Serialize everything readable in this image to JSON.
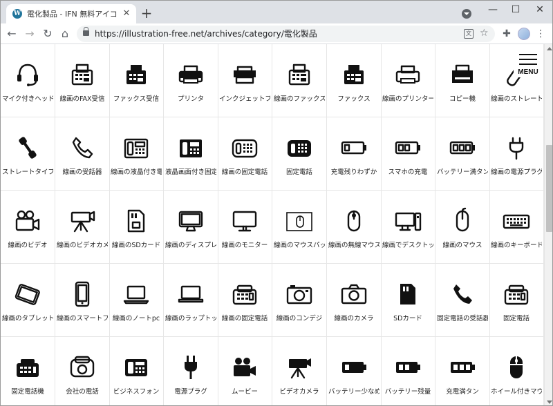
{
  "tab": {
    "title": "電化製品 - IFN 無料アイコン・S",
    "favicon": "wordpress-icon"
  },
  "toolbar": {
    "url": "https://illustration-free.net/archives/category/電化製品"
  },
  "page_menu": {
    "label": "MENU"
  },
  "icons": [
    {
      "label": "マイク付きヘッドセット",
      "icon": "headset-icon"
    },
    {
      "label": "線画のFAX受信",
      "icon": "fax-outline-icon"
    },
    {
      "label": "ファックス受信",
      "icon": "fax-filled-icon"
    },
    {
      "label": "プリンタ",
      "icon": "printer-icon"
    },
    {
      "label": "インクジェットプリンタ",
      "icon": "inkjet-printer-icon"
    },
    {
      "label": "線画のファックス",
      "icon": "fax-line-icon"
    },
    {
      "label": "ファックス",
      "icon": "fax-icon"
    },
    {
      "label": "線画のプリンター",
      "icon": "printer-outline-icon"
    },
    {
      "label": "コピー機",
      "icon": "copier-icon"
    },
    {
      "label": "線画のストレート",
      "icon": "receiver-outline-icon"
    },
    {
      "label": "ストレートタイプ",
      "icon": "receiver-filled-icon"
    },
    {
      "label": "線画の受話器",
      "icon": "handset-outline-icon"
    },
    {
      "label": "線画の液晶付き電話",
      "icon": "lcd-phone-outline-icon"
    },
    {
      "label": "液晶画面付き固定電話",
      "icon": "lcd-phone-filled-icon"
    },
    {
      "label": "線画の固定電話",
      "icon": "desk-phone-outline-icon"
    },
    {
      "label": "固定電話",
      "icon": "desk-phone-filled-icon"
    },
    {
      "label": "充電残りわずか",
      "icon": "battery-low-icon"
    },
    {
      "label": "スマホの充電",
      "icon": "battery-half-icon"
    },
    {
      "label": "バッテリー満タン",
      "icon": "battery-full-icon"
    },
    {
      "label": "線画の電源プラグ",
      "icon": "plug-outline-icon"
    },
    {
      "label": "線画のビデオ",
      "icon": "video-camera-outline-icon"
    },
    {
      "label": "線画のビデオカメラ",
      "icon": "tripod-camera-outline-icon"
    },
    {
      "label": "線画のSDカード",
      "icon": "sd-card-outline-icon"
    },
    {
      "label": "線画のディスプレイ",
      "icon": "display-outline-icon"
    },
    {
      "label": "線画のモニター",
      "icon": "monitor-outline-icon"
    },
    {
      "label": "線画のマウスパッド",
      "icon": "mousepad-icon"
    },
    {
      "label": "線画の無線マウス",
      "icon": "wireless-mouse-icon"
    },
    {
      "label": "線画でデスクトップ",
      "icon": "desktop-pc-icon"
    },
    {
      "label": "線画のマウス",
      "icon": "mouse-outline-icon"
    },
    {
      "label": "線画のキーボード",
      "icon": "keyboard-icon"
    },
    {
      "label": "線画のタブレット",
      "icon": "tablet-icon"
    },
    {
      "label": "線画のスマートフォン",
      "icon": "smartphone-icon"
    },
    {
      "label": "線画のノートpc",
      "icon": "laptop-icon"
    },
    {
      "label": "線画のラップトップ",
      "icon": "laptop-wide-icon"
    },
    {
      "label": "線画の固定電話",
      "icon": "office-phone-outline-icon"
    },
    {
      "label": "線画のコンデジ",
      "icon": "compact-camera-icon"
    },
    {
      "label": "線画のカメラ",
      "icon": "camera-outline-icon"
    },
    {
      "label": "SDカード",
      "icon": "sd-card-filled-icon"
    },
    {
      "label": "固定電話の受話器",
      "icon": "handset-filled-icon"
    },
    {
      "label": "固定電話",
      "icon": "office-phone-icon"
    },
    {
      "label": "固定電話機",
      "icon": "office-phone-filled-icon"
    },
    {
      "label": "会社の電話",
      "icon": "business-phone-icon"
    },
    {
      "label": "ビジネスフォン",
      "icon": "business-phone-filled-icon"
    },
    {
      "label": "電源プラグ",
      "icon": "plug-filled-icon"
    },
    {
      "label": "ムービー",
      "icon": "movie-camera-icon"
    },
    {
      "label": "ビデオカメラ",
      "icon": "tripod-camera-filled-icon"
    },
    {
      "label": "バッテリー少なめ",
      "icon": "battery-low-filled-icon"
    },
    {
      "label": "バッテリー残量",
      "icon": "battery-mid-filled-icon"
    },
    {
      "label": "充電満タン",
      "icon": "battery-full-filled-icon"
    },
    {
      "label": "ホイール付きマウス",
      "icon": "wheel-mouse-icon"
    }
  ]
}
